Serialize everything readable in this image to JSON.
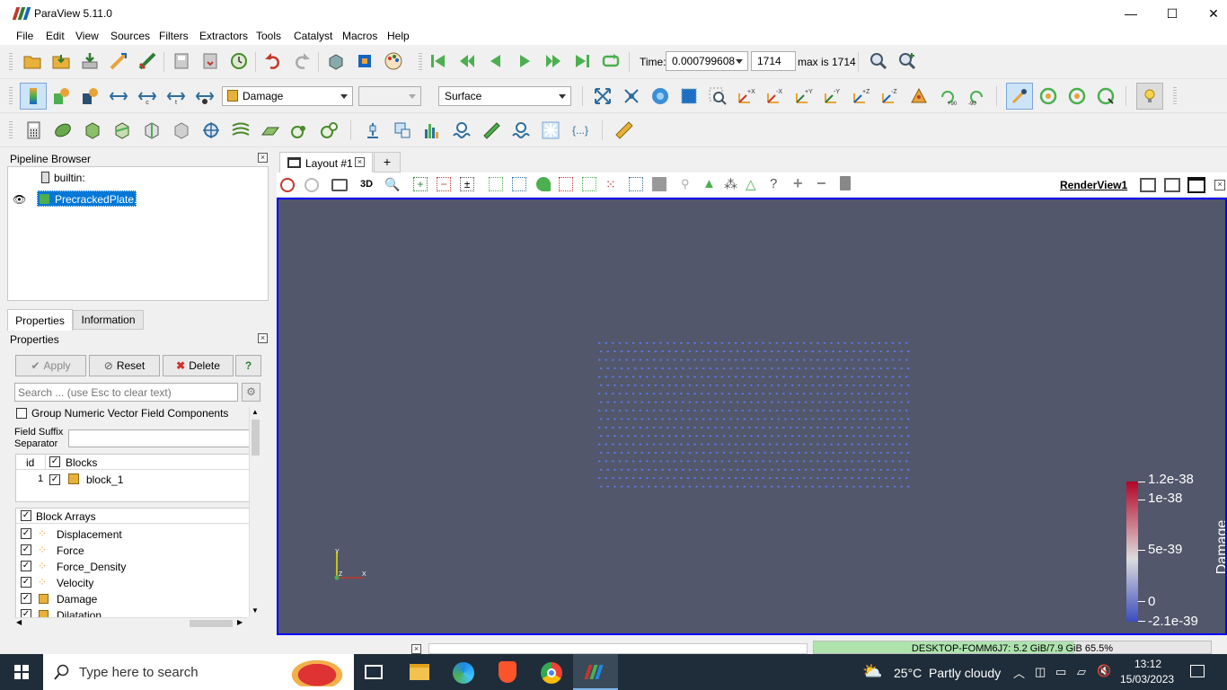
{
  "window": {
    "title": "ParaView 5.11.0",
    "controls": [
      "—",
      "☐",
      "✕"
    ]
  },
  "menu": [
    "File",
    "Edit",
    "View",
    "Sources",
    "Filters",
    "Extractors",
    "Tools",
    "Catalyst",
    "Macros",
    "Help"
  ],
  "time": {
    "label": "Time:",
    "value": "0.000799608",
    "step": "1714",
    "max": "max is 1714"
  },
  "toolbar2": {
    "color_by": "Damage",
    "component": "",
    "representation": "Surface"
  },
  "pipeline": {
    "title": "Pipeline Browser",
    "builtin": "builtin:",
    "source": "PrecrackedPlate.e"
  },
  "tabs": {
    "properties": "Properties",
    "information": "Information"
  },
  "properties": {
    "title": "Properties",
    "apply": "Apply",
    "reset": "Reset",
    "delete": "Delete",
    "help": "?",
    "search_placeholder": "Search ... (use Esc to clear text)",
    "group_numeric": "Group Numeric Vector Field Components",
    "field_suffix": "Field Suffix Separator",
    "blocks_header": {
      "id": "id",
      "name": "Blocks"
    },
    "block_row": {
      "id": "1",
      "name": "block_1"
    },
    "arrays_header": "Block Arrays",
    "arrays": [
      "Displacement",
      "Force",
      "Force_Density",
      "Velocity",
      "Damage",
      "Dilatation"
    ]
  },
  "layout": {
    "tab": "Layout #1",
    "add": "+",
    "mode3d": "3D",
    "render_view": "RenderView1"
  },
  "colorbar": {
    "title": "Damage",
    "labels": [
      "1.2e-38",
      "1e-38",
      "5e-39",
      "0",
      "-2.1e-39"
    ],
    "colors": [
      "#b40426",
      "#dddcdc",
      "#3b4cc0"
    ]
  },
  "axes": {
    "y": "Y",
    "z": "Z",
    "x": "X"
  },
  "status": {
    "memory": "DESKTOP-FOMM6J7: 5.2 GiB/7.9 GiB 65.5%",
    "memory_fraction": 0.655
  },
  "taskbar": {
    "search": "Type here to search",
    "weather": "25°C  Partly cloudy",
    "time": "13:12",
    "date": "15/03/2023"
  },
  "colors": {
    "view_bg": "#52576b",
    "selection": "#0078d7",
    "points": "#5b7cf0"
  }
}
